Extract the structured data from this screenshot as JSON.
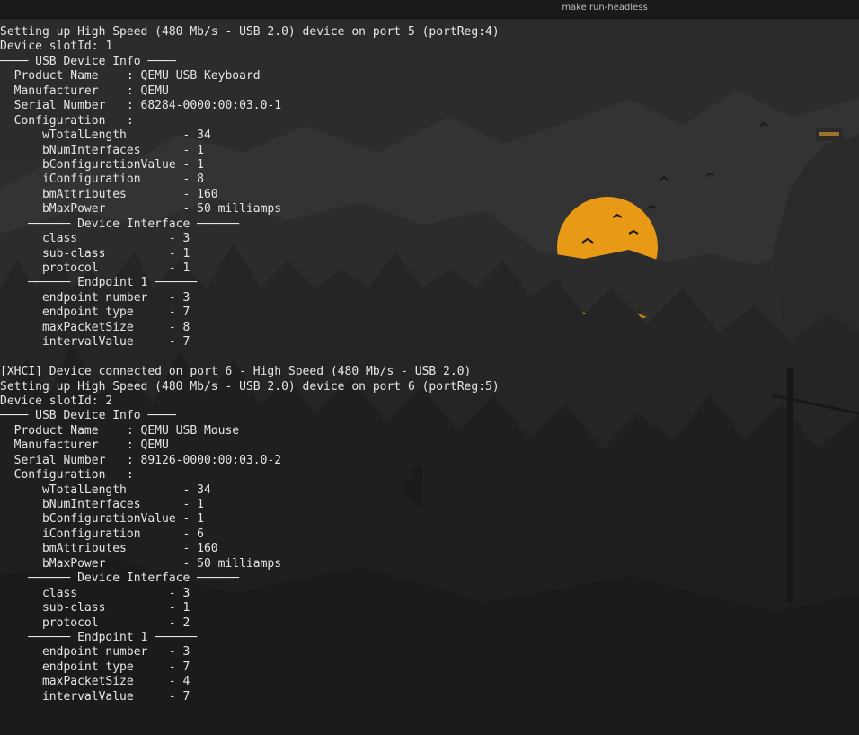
{
  "window": {
    "title": "make run-headless"
  },
  "terminal": {
    "lines": [
      "Setting up High Speed (480 Mb/s - USB 2.0) device on port 5 (portReg:4)",
      "Device slotId: 1",
      "──── USB Device Info ────",
      "  Product Name    : QEMU USB Keyboard",
      "  Manufacturer    : QEMU",
      "  Serial Number   : 68284-0000:00:03.0-1",
      "  Configuration   :",
      "      wTotalLength        - 34",
      "      bNumInterfaces      - 1",
      "      bConfigurationValue - 1",
      "      iConfiguration      - 8",
      "      bmAttributes        - 160",
      "      bMaxPower           - 50 milliamps",
      "    ────── Device Interface ──────",
      "      class             - 3",
      "      sub-class         - 1",
      "      protocol          - 1",
      "    ────── Endpoint 1 ──────",
      "      endpoint number   - 3",
      "      endpoint type     - 7",
      "      maxPacketSize     - 8",
      "      intervalValue     - 7",
      "",
      "[XHCI] Device connected on port 6 - High Speed (480 Mb/s - USB 2.0)",
      "Setting up High Speed (480 Mb/s - USB 2.0) device on port 6 (portReg:5)",
      "Device slotId: 2",
      "──── USB Device Info ────",
      "  Product Name    : QEMU USB Mouse",
      "  Manufacturer    : QEMU",
      "  Serial Number   : 89126-0000:00:03.0-2",
      "  Configuration   :",
      "      wTotalLength        - 34",
      "      bNumInterfaces      - 1",
      "      bConfigurationValue - 1",
      "      iConfiguration      - 6",
      "      bmAttributes        - 160",
      "      bMaxPower           - 50 milliamps",
      "    ────── Device Interface ──────",
      "      class             - 3",
      "      sub-class         - 1",
      "      protocol          - 2",
      "    ────── Endpoint 1 ──────",
      "      endpoint number   - 3",
      "      endpoint type     - 7",
      "      maxPacketSize     - 4",
      "      intervalValue     - 7"
    ]
  },
  "colors": {
    "sun": "#e89a17",
    "terminal_text": "#e6e6e6",
    "background": "#262626"
  }
}
